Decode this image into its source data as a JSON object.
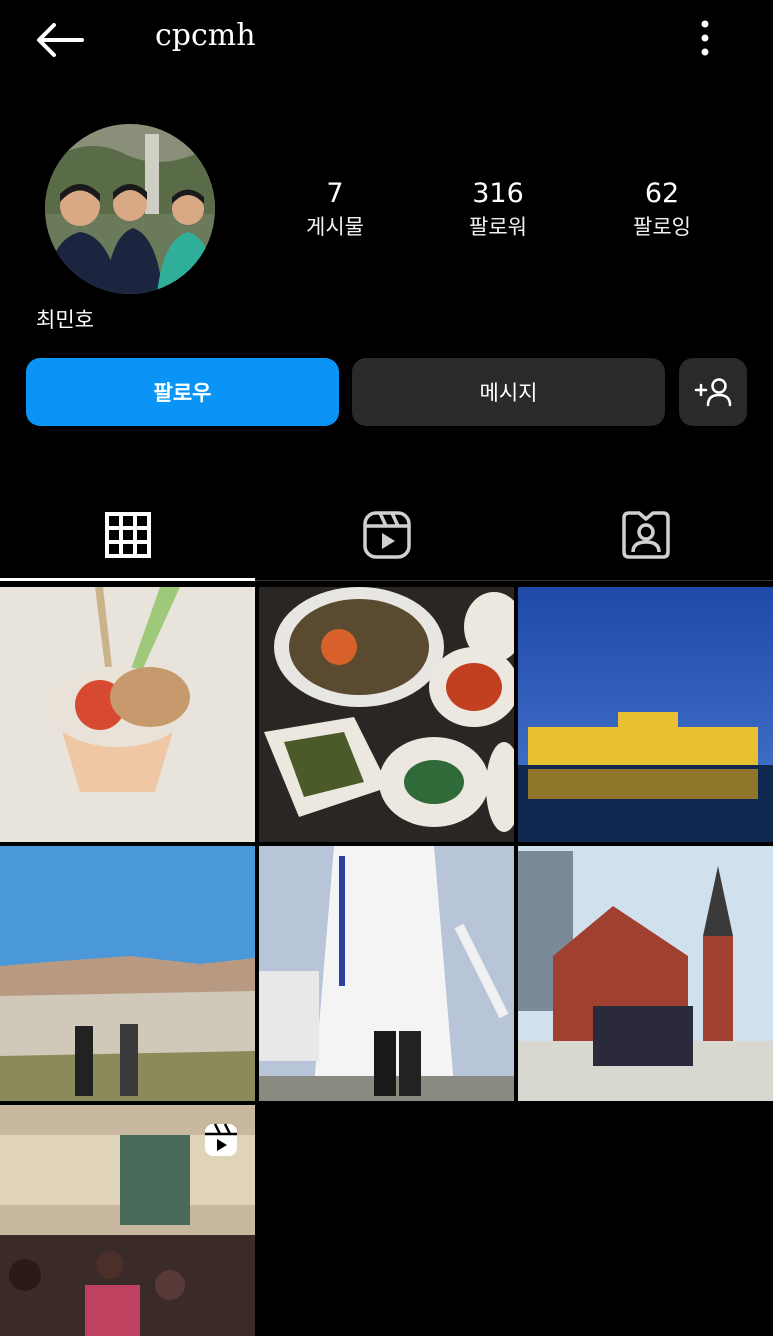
{
  "header": {
    "username": "cpcmh"
  },
  "profile": {
    "display_name": "최민호",
    "stats": [
      {
        "value": "7",
        "label": "게시물"
      },
      {
        "value": "316",
        "label": "팔로워"
      },
      {
        "value": "62",
        "label": "팔로잉"
      }
    ]
  },
  "actions": {
    "follow_label": "팔로우",
    "message_label": "메시지"
  },
  "tabs": [
    "posts-grid",
    "reels",
    "tagged"
  ],
  "colors": {
    "follow_blue": "#0a95f6",
    "button_gray": "#2a2a2a",
    "background": "#000000"
  },
  "posts_count_shown": 7
}
